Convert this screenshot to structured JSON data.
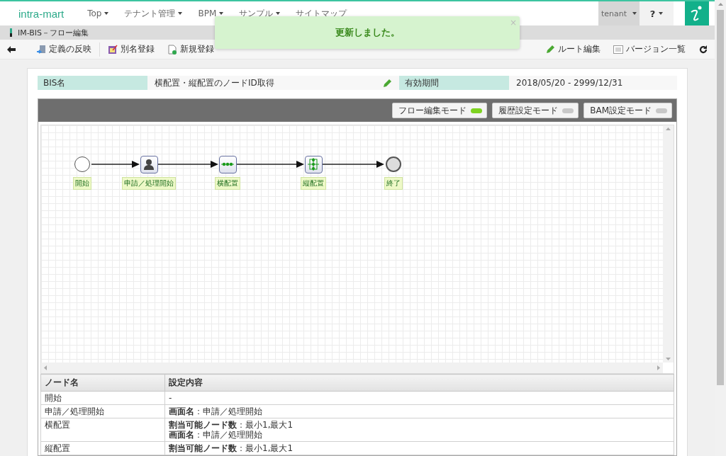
{
  "header": {
    "logo": "intra-mart",
    "menu": [
      {
        "label": "Top",
        "caret": true
      },
      {
        "label": "テナント管理",
        "caret": true
      },
      {
        "label": "BPM",
        "caret": true
      },
      {
        "label": "サンプル",
        "caret": true
      },
      {
        "label": "サイトマップ",
        "caret": false
      }
    ],
    "user": "tenant",
    "help": "?"
  },
  "title_bar": {
    "title": "IM-BIS－フロー編集"
  },
  "toolbar": {
    "left": [
      {
        "label": "定義の反映",
        "kind": "deploy"
      },
      {
        "label": "別名登録",
        "kind": "saveas"
      },
      {
        "label": "新規登録",
        "kind": "new"
      }
    ],
    "right": [
      {
        "label": "ルート編集",
        "kind": "edit"
      },
      {
        "label": "バージョン一覧",
        "kind": "list"
      }
    ]
  },
  "toast": {
    "message": "更新しました。",
    "close": "×"
  },
  "info": {
    "name_label": "BIS名",
    "name_value": "横配置・縦配置のノードID取得",
    "period_label": "有効期間",
    "period_value": "2018/05/20  -  2999/12/31"
  },
  "modes": [
    {
      "label": "フロー編集モード",
      "on": true
    },
    {
      "label": "履歴設定モード",
      "on": false
    },
    {
      "label": "BAM設定モード",
      "on": false
    }
  ],
  "flow": {
    "nodes": [
      {
        "kind": "start",
        "label": "開始"
      },
      {
        "kind": "user",
        "label": "申請／処理開始"
      },
      {
        "kind": "horizontal",
        "label": "横配置"
      },
      {
        "kind": "vertical",
        "label": "縦配置"
      },
      {
        "kind": "end",
        "label": "終了"
      }
    ]
  },
  "table": {
    "columns": [
      "ノード名",
      "設定内容"
    ],
    "rows": [
      {
        "name": "開始",
        "settings": [
          "-"
        ]
      },
      {
        "name": "申請／処理開始",
        "settings": [
          "**画面名**：申請／処理開始"
        ]
      },
      {
        "name": "横配置",
        "settings": [
          "**割当可能ノード数**：最小1,最大1",
          "**画面名**：申請／処理開始"
        ]
      },
      {
        "name": "縦配置",
        "settings": [
          "**割当可能ノード数**：最小1,最大1"
        ]
      }
    ]
  }
}
